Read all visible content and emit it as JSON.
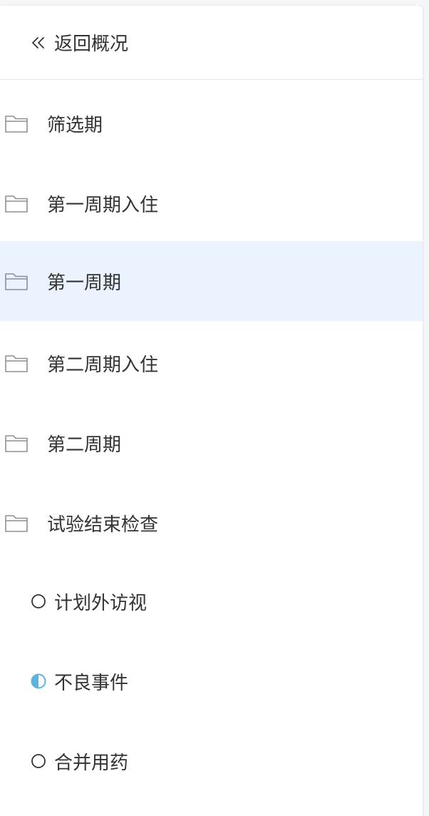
{
  "header": {
    "back_label": "返回概况",
    "icon": "double-chevron-left-icon"
  },
  "folders": [
    {
      "label": "筛选期",
      "icon": "folder-icon",
      "active": false
    },
    {
      "label": "第一周期入住",
      "icon": "folder-icon",
      "active": false
    },
    {
      "label": "第一周期",
      "icon": "folder-icon",
      "active": true
    },
    {
      "label": "第二周期入住",
      "icon": "folder-icon",
      "active": false
    },
    {
      "label": "第二周期",
      "icon": "folder-icon",
      "active": false
    },
    {
      "label": "试验结束检查",
      "icon": "folder-icon",
      "active": false
    }
  ],
  "forms": [
    {
      "label": "计划外访视",
      "status": "empty",
      "icon": "empty-circle-icon"
    },
    {
      "label": "不良事件",
      "status": "partial",
      "icon": "half-filled-circle-icon"
    },
    {
      "label": "合并用药",
      "status": "empty",
      "icon": "empty-circle-icon"
    }
  ],
  "colors": {
    "active_row_bg": "#eaf3fe",
    "partial_status": "#5ab4dc",
    "folder_stroke": "#8a8f99",
    "text": "#333333"
  }
}
